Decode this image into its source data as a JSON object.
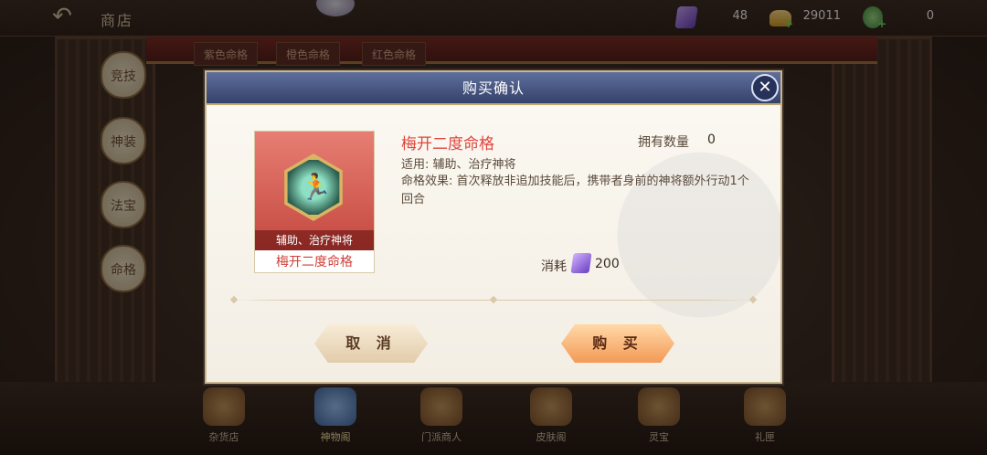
{
  "topbar": {
    "title": "商店",
    "currencies": [
      {
        "icon": "purple-ticket-icon",
        "value": "48"
      },
      {
        "icon": "gold-ingot-icon",
        "value": "29011"
      },
      {
        "icon": "green-gourd-icon",
        "value": "0"
      }
    ]
  },
  "background": {
    "top_tabs": [
      "紫色命格",
      "橙色命格",
      "红色命格"
    ],
    "side_tabs": [
      "竞技",
      "神装",
      "法宝",
      "命格"
    ],
    "bottom_nav": [
      {
        "label": "杂货店",
        "active": false
      },
      {
        "label": "神物阁",
        "active": true
      },
      {
        "label": "门派商人",
        "active": false
      },
      {
        "label": "皮肤阁",
        "active": false
      },
      {
        "label": "灵宝",
        "active": false
      },
      {
        "label": "礼匣",
        "active": false
      }
    ]
  },
  "modal": {
    "title": "购买确认",
    "close_symbol": "✕",
    "item": {
      "name": "梅开二度命格",
      "tag": "辅助、治疗神将",
      "card_name": "梅开二度命格",
      "applies": "适用: 辅助、治疗神将",
      "effect": "命格效果: 首次释放非追加技能后，携带者身前的神将额外行动1个回合",
      "own_label": "拥有数量",
      "own_count": "0"
    },
    "cost": {
      "label": "消耗",
      "currency_icon": "purple-ticket-icon",
      "amount": "200"
    },
    "buttons": {
      "cancel": "取 消",
      "buy": "购 买"
    }
  },
  "colors": {
    "header": "#34426b",
    "item_name": "#e0463d",
    "buy_button": "#f39a56"
  }
}
